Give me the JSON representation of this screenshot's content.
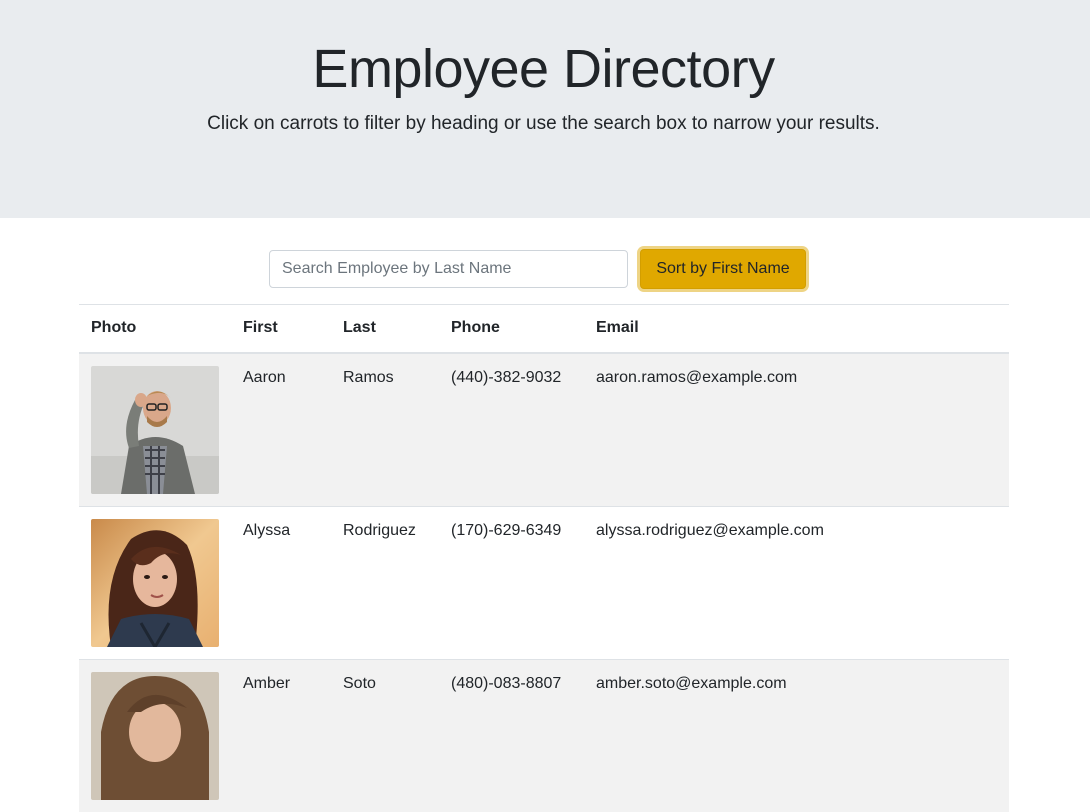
{
  "header": {
    "title": "Employee Directory",
    "subtitle": "Click on carrots to filter by heading or use the search box to narrow your results."
  },
  "search": {
    "placeholder": "Search Employee by Last Name",
    "value": ""
  },
  "sort_button": {
    "label": "Sort by First Name"
  },
  "table": {
    "columns": [
      "Photo",
      "First",
      "Last",
      "Phone",
      "Email"
    ],
    "rows": [
      {
        "first": "Aaron",
        "last": "Ramos",
        "phone": "(440)-382-9032",
        "email": "aaron.ramos@example.com"
      },
      {
        "first": "Alyssa",
        "last": "Rodriguez",
        "phone": "(170)-629-6349",
        "email": "alyssa.rodriguez@example.com"
      },
      {
        "first": "Amber",
        "last": "Soto",
        "phone": "(480)-083-8807",
        "email": "amber.soto@example.com"
      }
    ]
  },
  "colors": {
    "jumbotron_bg": "#e9ecef",
    "accent_button": "#e0a800",
    "row_stripe": "#f2f2f2",
    "border": "#dee2e6"
  }
}
